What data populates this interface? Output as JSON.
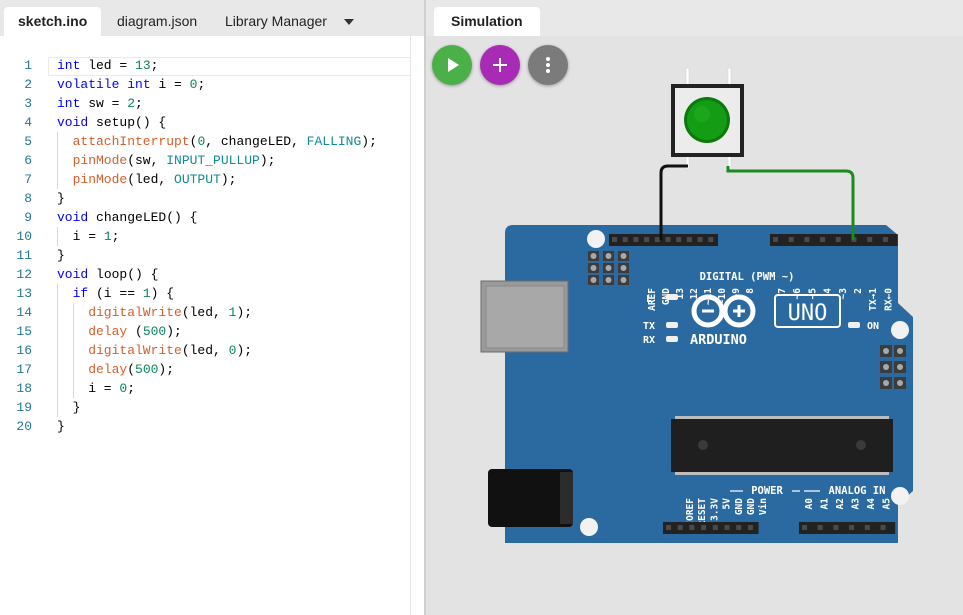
{
  "editor": {
    "tabs": [
      {
        "label": "sketch.ino",
        "active": true
      },
      {
        "label": "diagram.json",
        "active": false
      },
      {
        "label": "Library Manager",
        "active": false
      }
    ],
    "lines": [
      {
        "n": "1",
        "indent": 0,
        "tokens": [
          {
            "t": "int",
            "c": "kw"
          },
          {
            "t": " led = "
          },
          {
            "t": "13",
            "c": "num"
          },
          {
            "t": ";"
          }
        ]
      },
      {
        "n": "2",
        "indent": 0,
        "tokens": [
          {
            "t": "volatile",
            "c": "kw"
          },
          {
            "t": " "
          },
          {
            "t": "int",
            "c": "kw"
          },
          {
            "t": " i = "
          },
          {
            "t": "0",
            "c": "num"
          },
          {
            "t": ";"
          }
        ]
      },
      {
        "n": "3",
        "indent": 0,
        "tokens": [
          {
            "t": "int",
            "c": "kw"
          },
          {
            "t": " sw = "
          },
          {
            "t": "2",
            "c": "num"
          },
          {
            "t": ";"
          }
        ]
      },
      {
        "n": "4",
        "indent": 0,
        "tokens": [
          {
            "t": "void",
            "c": "kw"
          },
          {
            "t": " setup() {"
          }
        ]
      },
      {
        "n": "5",
        "indent": 1,
        "tokens": [
          {
            "t": "attachInterrupt",
            "c": "fn"
          },
          {
            "t": "("
          },
          {
            "t": "0",
            "c": "num"
          },
          {
            "t": ", changeLED, "
          },
          {
            "t": "FALLING",
            "c": "cst"
          },
          {
            "t": ");"
          }
        ]
      },
      {
        "n": "6",
        "indent": 1,
        "tokens": [
          {
            "t": "pinMode",
            "c": "fn"
          },
          {
            "t": "(sw, "
          },
          {
            "t": "INPUT_PULLUP",
            "c": "cst"
          },
          {
            "t": ");"
          }
        ]
      },
      {
        "n": "7",
        "indent": 1,
        "tokens": [
          {
            "t": "pinMode",
            "c": "fn"
          },
          {
            "t": "(led, "
          },
          {
            "t": "OUTPUT",
            "c": "cst"
          },
          {
            "t": ");"
          }
        ]
      },
      {
        "n": "8",
        "indent": 0,
        "tokens": [
          {
            "t": "}"
          }
        ]
      },
      {
        "n": "9",
        "indent": 0,
        "tokens": [
          {
            "t": "void",
            "c": "kw"
          },
          {
            "t": " changeLED() {"
          }
        ]
      },
      {
        "n": "10",
        "indent": 1,
        "tokens": [
          {
            "t": "i = "
          },
          {
            "t": "1",
            "c": "num"
          },
          {
            "t": ";"
          }
        ]
      },
      {
        "n": "11",
        "indent": 0,
        "tokens": [
          {
            "t": "}"
          }
        ]
      },
      {
        "n": "12",
        "indent": 0,
        "tokens": [
          {
            "t": "void",
            "c": "kw"
          },
          {
            "t": " loop() {"
          }
        ]
      },
      {
        "n": "13",
        "indent": 1,
        "tokens": [
          {
            "t": "if",
            "c": "kw"
          },
          {
            "t": " (i == "
          },
          {
            "t": "1",
            "c": "num"
          },
          {
            "t": ") {"
          }
        ]
      },
      {
        "n": "14",
        "indent": 2,
        "tokens": [
          {
            "t": "digitalWrite",
            "c": "fn"
          },
          {
            "t": "(led, "
          },
          {
            "t": "1",
            "c": "num"
          },
          {
            "t": ");"
          }
        ]
      },
      {
        "n": "15",
        "indent": 2,
        "tokens": [
          {
            "t": "delay",
            "c": "fn"
          },
          {
            "t": " ("
          },
          {
            "t": "500",
            "c": "num"
          },
          {
            "t": ");"
          }
        ]
      },
      {
        "n": "16",
        "indent": 2,
        "tokens": [
          {
            "t": "digitalWrite",
            "c": "fn"
          },
          {
            "t": "(led, "
          },
          {
            "t": "0",
            "c": "num"
          },
          {
            "t": ");"
          }
        ]
      },
      {
        "n": "17",
        "indent": 2,
        "tokens": [
          {
            "t": "delay",
            "c": "fn"
          },
          {
            "t": "("
          },
          {
            "t": "500",
            "c": "num"
          },
          {
            "t": ");"
          }
        ]
      },
      {
        "n": "18",
        "indent": 2,
        "tokens": [
          {
            "t": "i = "
          },
          {
            "t": "0",
            "c": "num"
          },
          {
            "t": ";"
          }
        ]
      },
      {
        "n": "19",
        "indent": 1,
        "tokens": [
          {
            "t": "}"
          }
        ]
      },
      {
        "n": "20",
        "indent": 0,
        "tokens": [
          {
            "t": "}"
          }
        ]
      }
    ],
    "token_colors": {
      "kw": "#0000ff",
      "fn": "#d35f2c",
      "num": "#098658",
      "cst": "#0e8a99",
      "plain": "#000000",
      "line_number": "#237893"
    }
  },
  "simulation": {
    "tab_label": "Simulation",
    "toolbar": {
      "run_icon": "play-icon",
      "add_icon": "plus-icon",
      "more_icon": "more-vertical-icon"
    },
    "board": {
      "model": "UNO",
      "brand": "ARDUINO",
      "color": "#2b6aa0",
      "digital_header_label": "DIGITAL (PWM ~)",
      "pin_labels_left": [
        "AREF",
        "GND",
        "13",
        "12",
        "~11",
        "~10",
        "~9",
        "8"
      ],
      "pin_labels_right": [
        "7",
        "~6",
        "~5",
        "4",
        "~3",
        "2",
        "TX→1",
        "RX←0"
      ],
      "led_labels": {
        "l": "L",
        "tx": "TX",
        "rx": "RX",
        "on": "ON"
      },
      "power_header_label": "POWER",
      "analog_header_label": "ANALOG IN",
      "power_pins": [
        "IOREF",
        "RESET",
        "3.3V",
        "5V",
        "GND",
        "GND",
        "Vin"
      ],
      "analog_pins": [
        "A0",
        "A1",
        "A2",
        "A3",
        "A4",
        "A5"
      ]
    },
    "pushbutton": {
      "cap_color": "#138a13"
    },
    "wires": [
      {
        "from": "pushbutton",
        "to": "GND",
        "color": "#111111"
      },
      {
        "from": "pushbutton",
        "to": "2",
        "color": "#1c8a1c"
      }
    ]
  }
}
